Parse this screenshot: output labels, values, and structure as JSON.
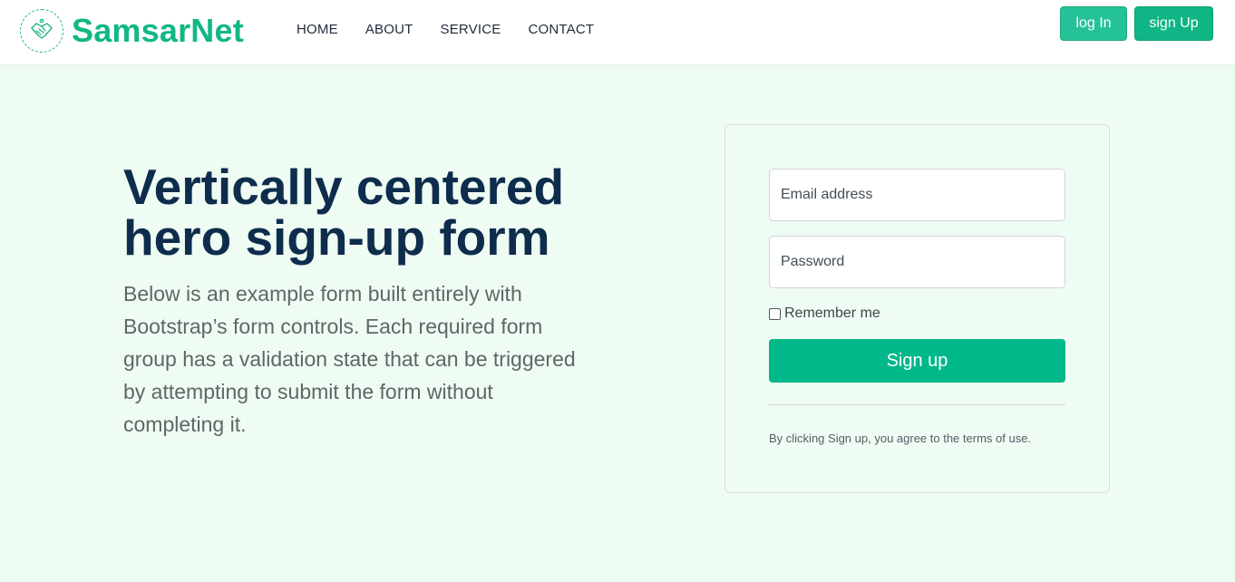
{
  "brand": {
    "name": "SamsarNet",
    "logo_icon": "handshake-icon",
    "color": "#12b784"
  },
  "nav": {
    "links": [
      "HOME",
      "ABOUT",
      "SERVICE",
      "CONTACT"
    ]
  },
  "header_buttons": {
    "login_label": "log In",
    "signup_label": "sign Up"
  },
  "hero": {
    "title": "Vertically centered hero sign-up form",
    "text": "Below is an example form built entirely with Bootstrap’s form controls. Each required form group has a validation state that can be triggered by attempting to submit the form without completing it."
  },
  "form": {
    "email_placeholder": "Email address",
    "password_placeholder": "Password",
    "remember_label": "Remember me",
    "remember_checked": false,
    "submit_label": "Sign up",
    "terms_text": "By clicking Sign up, you agree to the terms of use."
  },
  "colors": {
    "accent": "#00b88a",
    "page_background": "#effcf3",
    "heading": "#0e2c4c"
  }
}
